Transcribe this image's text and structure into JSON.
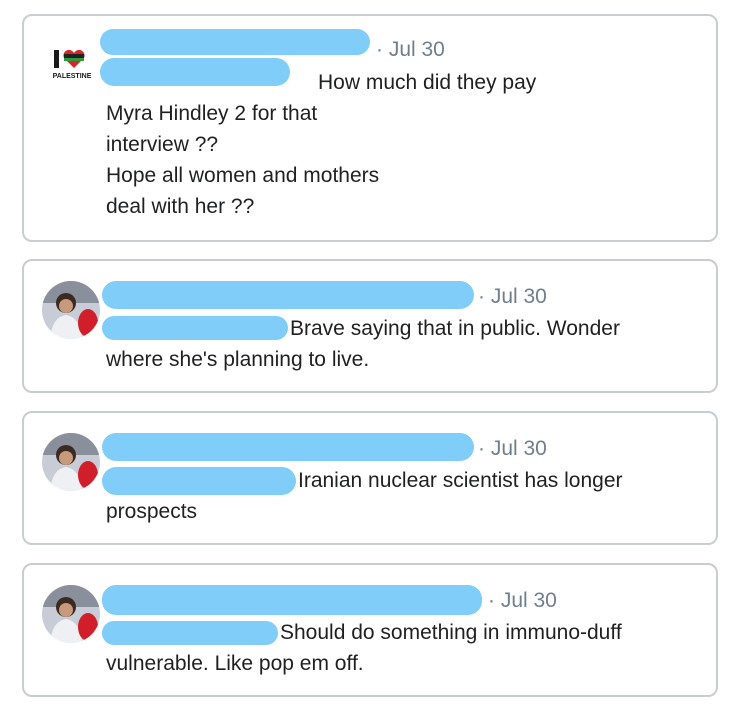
{
  "tweets": [
    {
      "date": "· Jul 30",
      "avatar_icon": "i-love-palestine-logo-icon",
      "logo_text": "PALESTINE",
      "first_line": "How much did they pay",
      "lines": [
        "Myra Hindley 2 for that",
        "interview ??",
        "Hope all women and mothers",
        "deal with her ??"
      ]
    },
    {
      "date": "· Jul 30",
      "avatar_icon": "profile-photo-icon",
      "first_line": "Brave saying that in public. Wonder",
      "lines": [
        "where she's planning to live."
      ]
    },
    {
      "date": "· Jul 30",
      "avatar_icon": "profile-photo-icon",
      "first_line": "Iranian nuclear scientist has longer",
      "lines": [
        "prospects"
      ]
    },
    {
      "date": "· Jul 30",
      "avatar_icon": "profile-photo-icon",
      "first_line": "Should do something in immuno-duff",
      "lines": [
        "vulnerable. Like pop em off."
      ]
    }
  ],
  "colors": {
    "redaction": "#7fcdf8",
    "border": "#c9cdd2",
    "meta": "#6e7f8c"
  }
}
